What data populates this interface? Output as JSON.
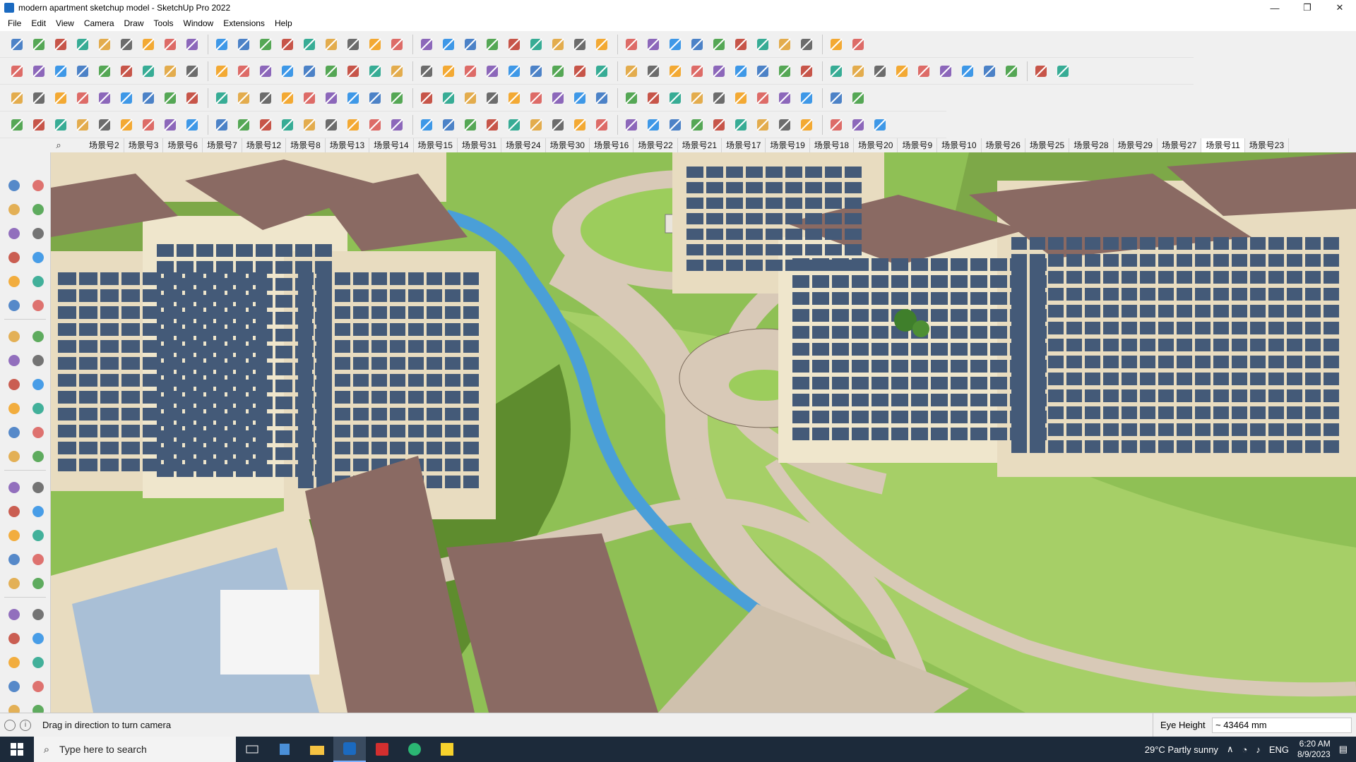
{
  "window": {
    "title": "modern apartment sketchup model - SketchUp Pro 2022",
    "minimize_glyph": "—",
    "restore_glyph": "❐",
    "close_glyph": "✕"
  },
  "menu": [
    "File",
    "Edit",
    "View",
    "Camera",
    "Draw",
    "Tools",
    "Window",
    "Extensions",
    "Help"
  ],
  "scenes": {
    "search_glyph": "⌕",
    "tabs": [
      "场景号2",
      "场景号3",
      "场景号6",
      "场景号7",
      "场景号12",
      "场景号8",
      "场景号13",
      "场景号14",
      "场景号15",
      "场景号31",
      "场景号24",
      "场景号30",
      "场景号16",
      "场景号22",
      "场景号21",
      "场景号17",
      "场景号19",
      "场景号18",
      "场景号20",
      "场景号9",
      "场景号10",
      "场景号26",
      "场景号25",
      "场景号28",
      "场景号29",
      "场景号27",
      "场景号11",
      "场景号23"
    ],
    "active": "场景号11"
  },
  "status": {
    "hint": "Drag in direction to turn camera",
    "measurement_label": "Eye Height",
    "measurement_value": "~ 43464 mm",
    "info_glyph": "i"
  },
  "taskbar": {
    "search_placeholder": "Type here to search",
    "weather": "29°C  Partly sunny",
    "language": "ENG",
    "time": "6:20 AM",
    "date": "8/9/2023"
  },
  "colors": {
    "accent": "#1b6ac0",
    "taskbar": "#1c2a3a",
    "grass": "#8bbf4f",
    "grass_dark": "#5e8c2e",
    "path": "#d8c9b7",
    "water": "#4a9fd8",
    "roof": "#8a6a63",
    "facade": "#e8dcc0",
    "window": "#445a78"
  }
}
